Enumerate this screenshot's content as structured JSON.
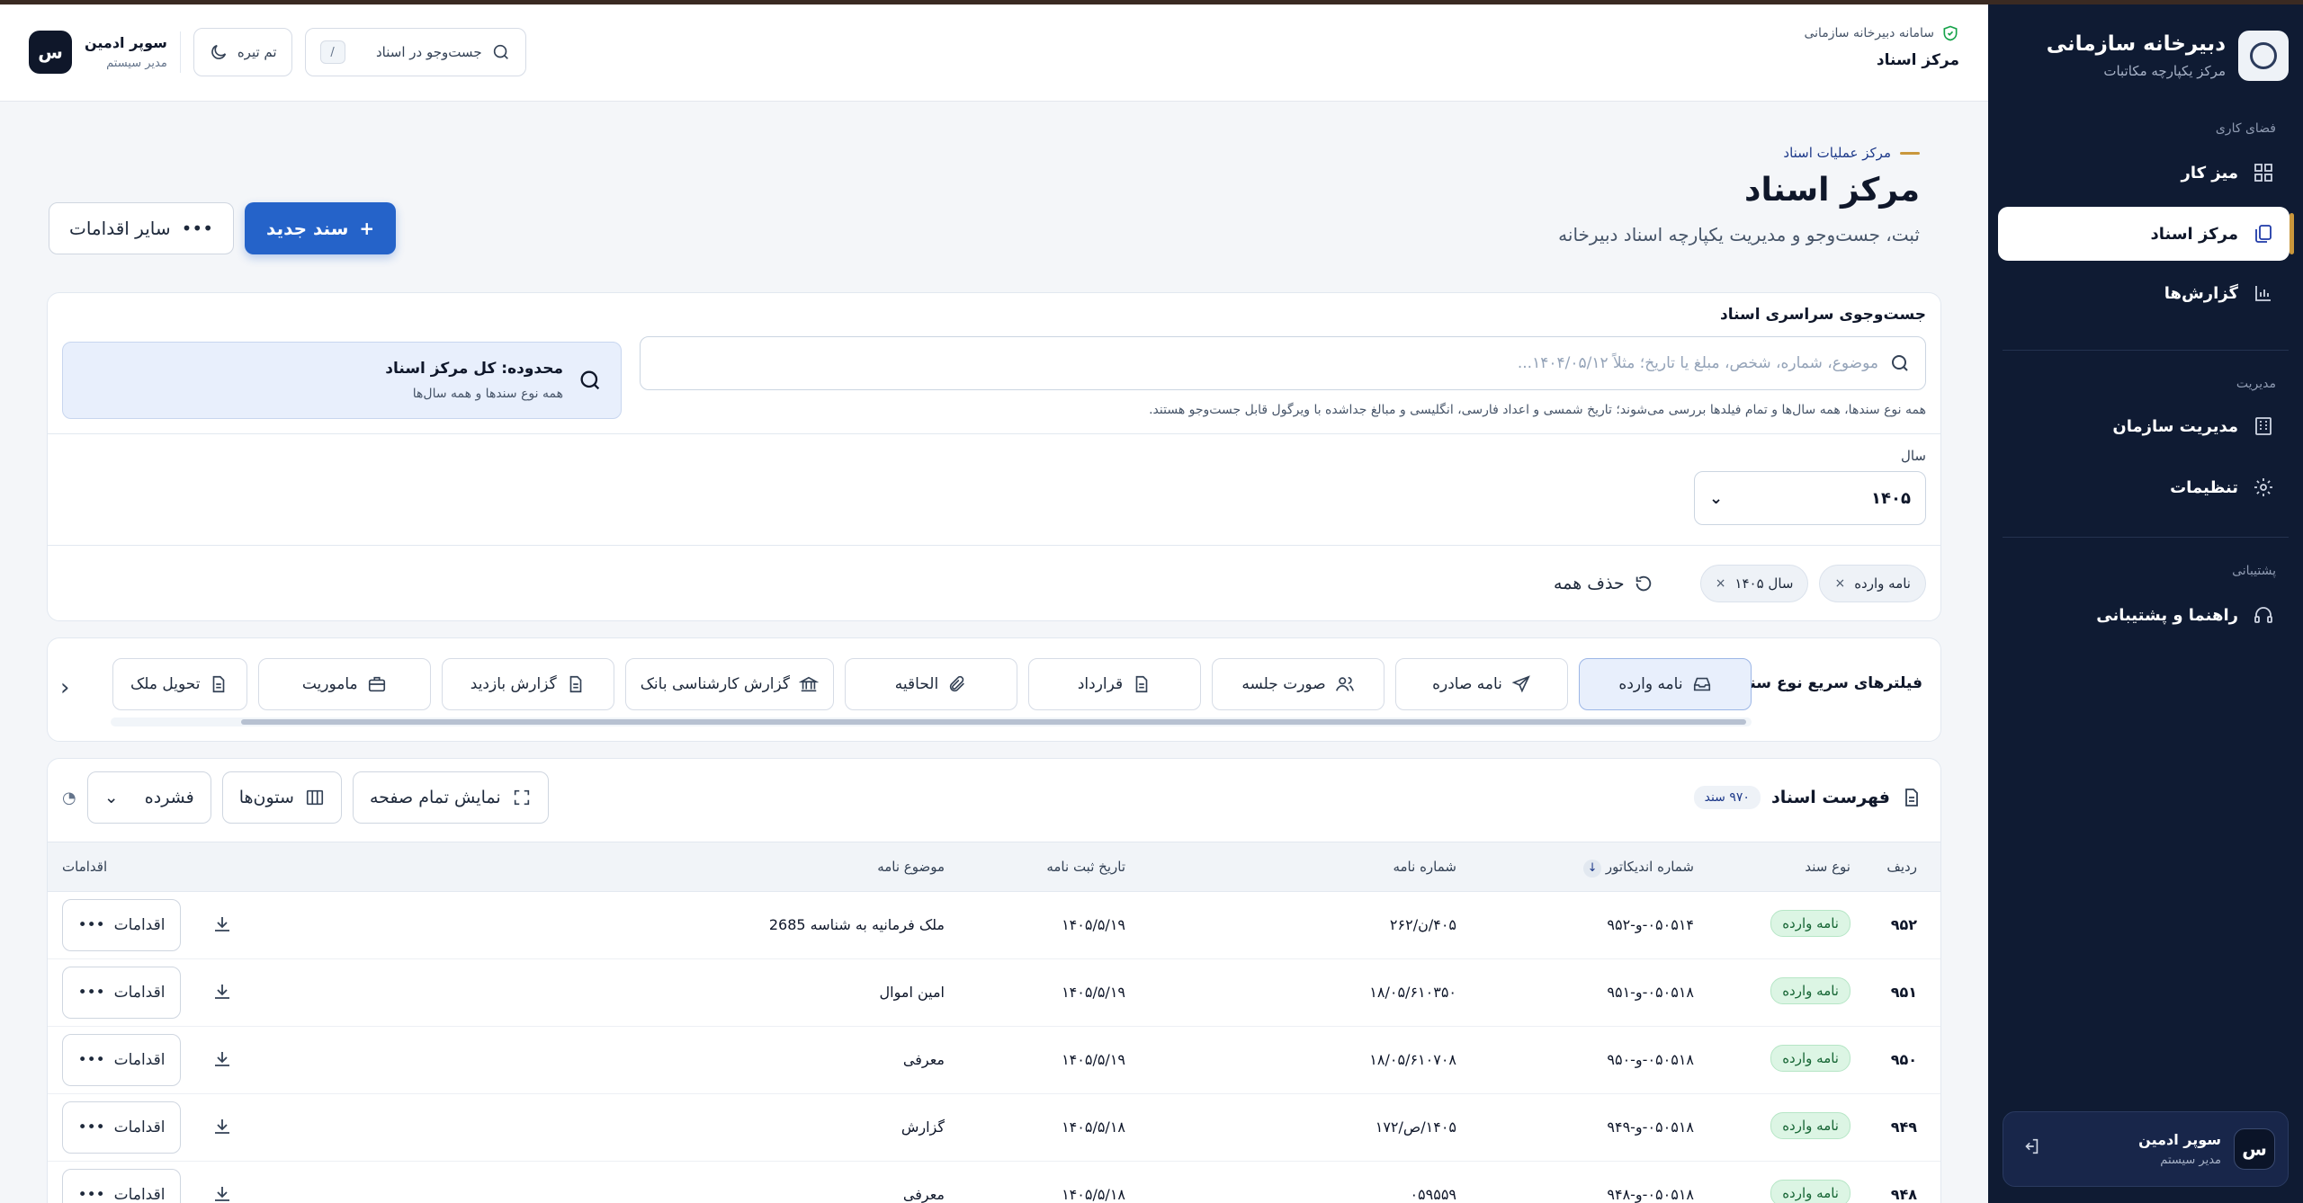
{
  "sidebar": {
    "title": "دبیرخانه سازمانی",
    "subtitle": "مرکز یکپارچه مکاتبات",
    "sections": {
      "workspace": "فضای کاری",
      "management": "مدیریت",
      "support": "پشتیبانی"
    },
    "items": [
      {
        "label": "میز کار",
        "icon": "dashboard-icon"
      },
      {
        "label": "مرکز اسناد",
        "icon": "documents-icon",
        "active": true
      },
      {
        "label": "گزارش‌ها",
        "icon": "reports-icon"
      },
      {
        "label": "مدیریت سازمان",
        "icon": "building-icon"
      },
      {
        "label": "تنظیمات",
        "icon": "gear-icon"
      },
      {
        "label": "راهنما و پشتیبانی",
        "icon": "headset-icon"
      }
    ],
    "user": {
      "initial": "س",
      "name": "سوپر ادمین",
      "role": "مدیر سیستم"
    }
  },
  "header": {
    "system": "سامانه دبیرخانه سازمانی",
    "page": "مرکز اسناد",
    "search_label": "جست‌وجو در اسناد",
    "search_shortcut": "/",
    "theme_label": "تم تیره",
    "user": {
      "initial": "س",
      "name": "سوپر ادمین",
      "role": "مدیر سیستم"
    }
  },
  "page": {
    "eyebrow": "مرکز عملیات اسناد",
    "title": "مرکز اسناد",
    "description": "ثبت، جست‌وجو و مدیریت یکپارچه اسناد دبیرخانه",
    "new_doc": "سند جدید",
    "other_actions": "سایر اقدامات"
  },
  "search": {
    "label": "جست‌وجوی سراسری اسناد",
    "placeholder": "موضوع، شماره، شخص، مبلغ یا تاریخ؛ مثلاً ۱۴۰۴/۰۵/۱۲...",
    "hint": "همه نوع سندها، همه سال‌ها و تمام فیلدها بررسی می‌شوند؛ تاریخ شمسی و اعداد فارسی، انگلیسی و مبالغ جداشده با ویرگول قابل جست‌وجو هستند.",
    "scope_title": "محدوده: کل مرکز اسناد",
    "scope_sub": "همه نوع سندها و همه سال‌ها",
    "year_label": "سال",
    "year_value": "۱۴۰۵",
    "chips": [
      "نامه وارده",
      "سال ۱۴۰۵"
    ],
    "clear_all": "حذف همه"
  },
  "quick_filters": {
    "label": "فیلترهای سریع نوع سند",
    "items": [
      {
        "label": "نامه وارده",
        "icon": "inbox-icon",
        "active": true
      },
      {
        "label": "نامه صادره",
        "icon": "send-icon"
      },
      {
        "label": "صورت جلسه",
        "icon": "people-icon"
      },
      {
        "label": "قرارداد",
        "icon": "file-icon"
      },
      {
        "label": "الحاقیه",
        "icon": "paperclip-icon"
      },
      {
        "label": "گزارش کارشناسی بانک",
        "icon": "bank-icon"
      },
      {
        "label": "گزارش بازدید",
        "icon": "file-icon"
      },
      {
        "label": "ماموریت",
        "icon": "briefcase-icon"
      },
      {
        "label": "تحویل ملک",
        "icon": "file-icon"
      }
    ]
  },
  "list": {
    "title": "فهرست اسناد",
    "count": "۹۷۰ سند",
    "density": "فشرده",
    "columns_label": "ستون‌ها",
    "fullscreen_label": "نمایش تمام صفحه",
    "headers": {
      "row": "ردیف",
      "type": "نوع سند",
      "indicator": "شماره اندیکاتور",
      "number": "شماره نامه",
      "date": "تاریخ ثبت نامه",
      "subject": "موضوع نامه",
      "actions": "اقدامات"
    },
    "action_label": "اقدامات",
    "rows": [
      {
        "row": "۹۵۲",
        "type": "نامه وارده",
        "indicator": "۰۵۰۵۱۴-و-۹۵۲",
        "number": "۴۰۵/ن/۲۶۲",
        "date": "۱۴۰۵/۵/۱۹",
        "subject": "ملک فرمانیه به شناسه 2685"
      },
      {
        "row": "۹۵۱",
        "type": "نامه وارده",
        "indicator": "۰۵۰۵۱۸-و-۹۵۱",
        "number": "۱۸/۰۵/۶۱۰۳۵۰",
        "date": "۱۴۰۵/۵/۱۹",
        "subject": "امین اموال"
      },
      {
        "row": "۹۵۰",
        "type": "نامه وارده",
        "indicator": "۰۵۰۵۱۸-و-۹۵۰",
        "number": "۱۸/۰۵/۶۱۰۷۰۸",
        "date": "۱۴۰۵/۵/۱۹",
        "subject": "معرفی"
      },
      {
        "row": "۹۴۹",
        "type": "نامه وارده",
        "indicator": "۰۵۰۵۱۸-و-۹۴۹",
        "number": "۱۴۰۵/ص/۱۷۲",
        "date": "۱۴۰۵/۵/۱۸",
        "subject": "گزارش"
      },
      {
        "row": "۹۴۸",
        "type": "نامه وارده",
        "indicator": "۰۵۰۵۱۸-و-۹۴۸",
        "number": "۰۵۹۵۵۹",
        "date": "۱۴۰۵/۵/۱۸",
        "subject": "معرفی"
      }
    ]
  }
}
